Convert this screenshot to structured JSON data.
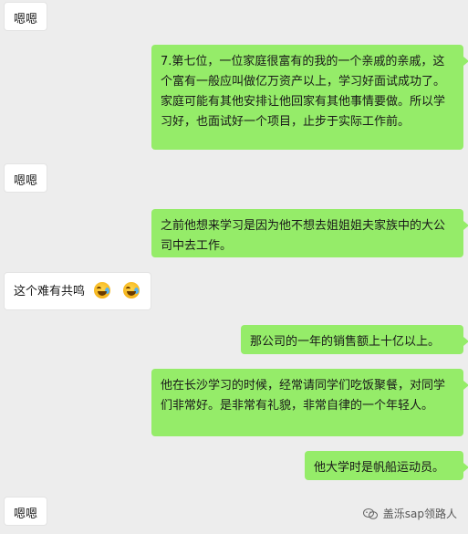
{
  "messages": [
    {
      "side": "left",
      "text": "嗯嗯"
    },
    {
      "side": "right",
      "text": "7.第七位，一位家庭很富有的我的一个亲戚的亲戚，这个富有一般应叫做亿万资产以上，学习好面试成功了。家庭可能有其他安排让他回家有其他事情要做。所以学习好，也面试好一个项目，止步于实际工作前。"
    },
    {
      "side": "left",
      "text": "嗯嗯"
    },
    {
      "side": "right",
      "text": "之前他想来学习是因为他不想去姐姐姐夫家族中的大公司中去工作。"
    },
    {
      "side": "left",
      "text": "这个难有共鸣",
      "emojis": [
        "crying-laughing-emoji",
        "crying-laughing-emoji"
      ]
    },
    {
      "side": "right",
      "text": "那公司的一年的销售额上十亿以上。"
    },
    {
      "side": "right",
      "text": "他在长沙学习的时候，经常请同学们吃饭聚餐，对同学们非常好。是非常有礼貌，非常自律的一个年轻人。"
    },
    {
      "side": "right",
      "text": "他大学时是帆船运动员。"
    },
    {
      "side": "left",
      "text": "嗯嗯"
    }
  ],
  "watermark": {
    "text": "盖泺sap领路人",
    "icon": "wechat-icon"
  },
  "colors": {
    "background": "#ededed",
    "right_bubble": "#95ec69",
    "left_bubble": "#ffffff"
  }
}
